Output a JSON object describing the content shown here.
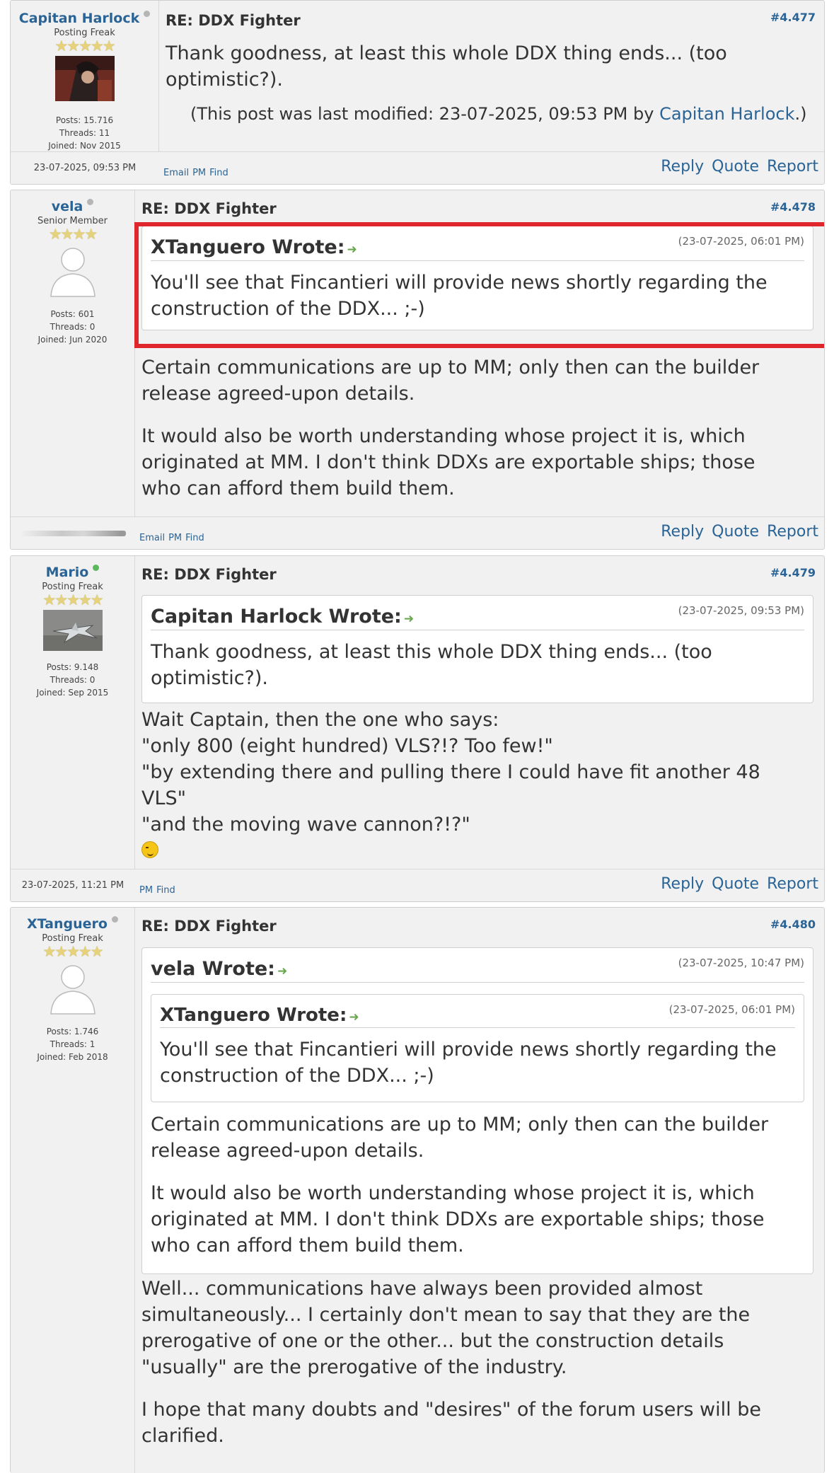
{
  "posts": [
    {
      "author": {
        "name": "Capitan Harlock",
        "status": "offline",
        "rank": "Posting Freak",
        "stars": "★★★★★",
        "posts": "Posts: 15.716",
        "threads": "Threads: 11",
        "joined": "Joined: Nov 2015"
      },
      "subject": "RE: DDX Fighter",
      "post_id": "#4.477",
      "body": [
        "Thank goodness, at least this whole DDX thing ends... (too",
        "optimistic?)."
      ],
      "edit_note": {
        "prefix": "(This post was last modified: 23-07-2025, 09:53 PM by ",
        "user": "Capitan Harlock",
        "suffix": ".)"
      },
      "date": "23-07-2025, 09:53 PM",
      "small_links": [
        "Email",
        "PM",
        "Find"
      ],
      "actions": [
        "Reply",
        "Quote",
        "Report"
      ]
    },
    {
      "author": {
        "name": "vela",
        "status": "offline",
        "rank": "Senior Member",
        "stars": "★★★★",
        "posts": "Posts: 601",
        "threads": "Threads: 0",
        "joined": "Joined: Jun 2020"
      },
      "subject": "RE: DDX Fighter",
      "post_id": "#4.478",
      "quote": {
        "author": "XTanguero Wrote:",
        "date": "(23-07-2025, 06:01 PM)",
        "lines": [
          "You'll see that Fincantieri will provide news shortly regarding the",
          "construction of the DDX... ;-)"
        ]
      },
      "paragraphs": [
        [
          "Certain communications are up to MM; only then can the builder",
          "release agreed-upon details."
        ],
        [
          "It would also be worth understanding whose project it is, which",
          "originated at MM. I don't think DDXs are exportable ships; those",
          "who can afford them build them."
        ]
      ],
      "small_links": [
        "Email",
        "PM",
        "Find"
      ],
      "actions": [
        "Reply",
        "Quote",
        "Report"
      ]
    },
    {
      "author": {
        "name": "Mario",
        "status": "online",
        "rank": "Posting Freak",
        "stars": "★★★★★",
        "posts": "Posts: 9.148",
        "threads": "Threads: 0",
        "joined": "Joined: Sep 2015"
      },
      "subject": "RE: DDX Fighter",
      "post_id": "#4.479",
      "quote": {
        "author": "Capitan Harlock Wrote:",
        "date": "(23-07-2025, 09:53 PM)",
        "lines": [
          "Thank goodness, at least this whole DDX thing ends... (too",
          "optimistic?)."
        ]
      },
      "lines": [
        "Wait Captain, then the one who says:",
        "\"only 800 (eight hundred) VLS?!? Too few!\"",
        "\"by extending there and pulling there I could have fit another 48",
        "VLS\"",
        "\"and the moving wave cannon?!?\""
      ],
      "date": "23-07-2025, 11:21 PM",
      "small_links": [
        "PM",
        "Find"
      ],
      "actions": [
        "Reply",
        "Quote",
        "Report"
      ]
    },
    {
      "author": {
        "name": "XTanguero",
        "status": "offline",
        "rank": "Posting Freak",
        "stars": "★★★★★",
        "posts": "Posts: 1.746",
        "threads": "Threads: 1",
        "joined": "Joined: Feb 2018"
      },
      "subject": "RE: DDX Fighter",
      "post_id": "#4.480",
      "quote": {
        "author": "vela Wrote:",
        "date": "(23-07-2025, 10:47 PM)",
        "inner": {
          "author": "XTanguero Wrote:",
          "date": "(23-07-2025, 06:01 PM)",
          "lines": [
            "You'll see that Fincantieri will provide news shortly regarding the",
            "construction of the DDX... ;-)"
          ]
        },
        "paragraphs": [
          [
            "Certain communications are up to MM; only then can the builder",
            "release agreed-upon details."
          ],
          [
            "It would also be worth understanding whose project it is, which",
            "originated at MM. I don't think DDXs are exportable ships; those",
            "who can afford them build them."
          ]
        ]
      },
      "paragraphs": [
        [
          "Well... communications have always been provided almost",
          "simultaneously... I certainly don't mean to say that they are the",
          "prerogative of one or the other... but the construction details",
          "\"usually\" are the prerogative of the industry."
        ],
        [
          "I hope that many doubts and \"desires\" of the forum users will be",
          "clarified."
        ]
      ]
    }
  ],
  "colors": {
    "link": "#2a6496",
    "highlight": "#e0262d",
    "online": "#5cb85c"
  }
}
